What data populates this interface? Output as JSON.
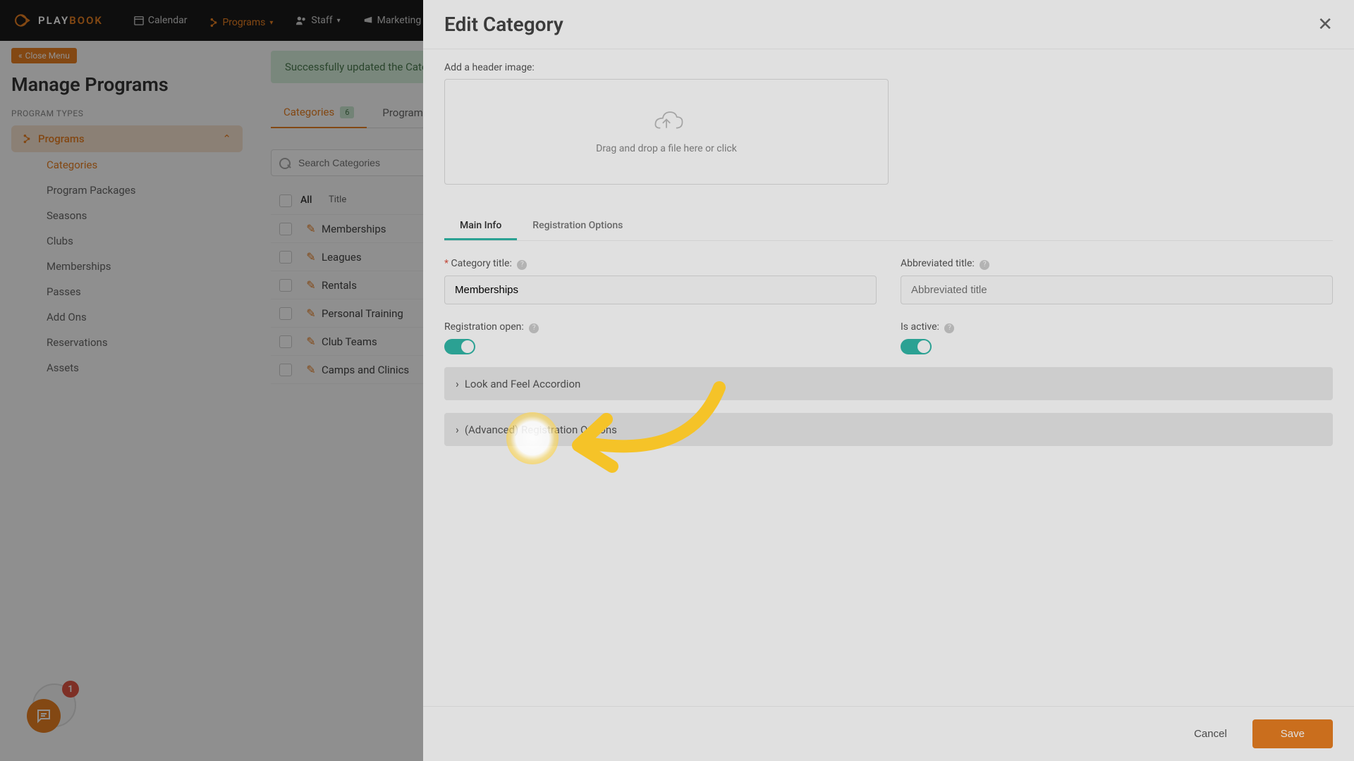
{
  "brand": {
    "part1": "PLAY",
    "part2": "BOOK"
  },
  "nav": {
    "calendar": "Calendar",
    "programs": "Programs",
    "staff": "Staff",
    "marketing": "Marketing"
  },
  "sidebar": {
    "close_menu": "Close Menu",
    "page_title": "Manage Programs",
    "section_label": "PROGRAM TYPES",
    "programs": "Programs",
    "items": [
      "Categories",
      "Program Packages",
      "Seasons",
      "Clubs",
      "Memberships",
      "Passes",
      "Add Ons",
      "Reservations",
      "Assets"
    ]
  },
  "content": {
    "alert": "Successfully updated the Category",
    "tabs": {
      "categories": "Categories",
      "count": "6",
      "programs": "Programs"
    },
    "search_placeholder": "Search Categories",
    "col_all": "All",
    "col_title": "Title",
    "rows": [
      "Memberships",
      "Leagues",
      "Rentals",
      "Personal Training",
      "Club Teams",
      "Camps and Clinics"
    ]
  },
  "modal": {
    "title": "Edit Category",
    "header_image_label": "Add a header image:",
    "dropzone_text": "Drag and drop a file here or click",
    "tabs": {
      "main": "Main Info",
      "reg": "Registration Options"
    },
    "category_title_label": "Category title:",
    "category_title_value": "Memberships",
    "abbrev_label": "Abbreviated title:",
    "abbrev_placeholder": "Abbreviated title",
    "reg_open_label": "Registration open:",
    "is_active_label": "Is active:",
    "accordion1": "Look and Feel Accordion",
    "accordion2": "(Advanced) Registration Options",
    "cancel": "Cancel",
    "save": "Save"
  },
  "chat": {
    "badge": "1"
  }
}
